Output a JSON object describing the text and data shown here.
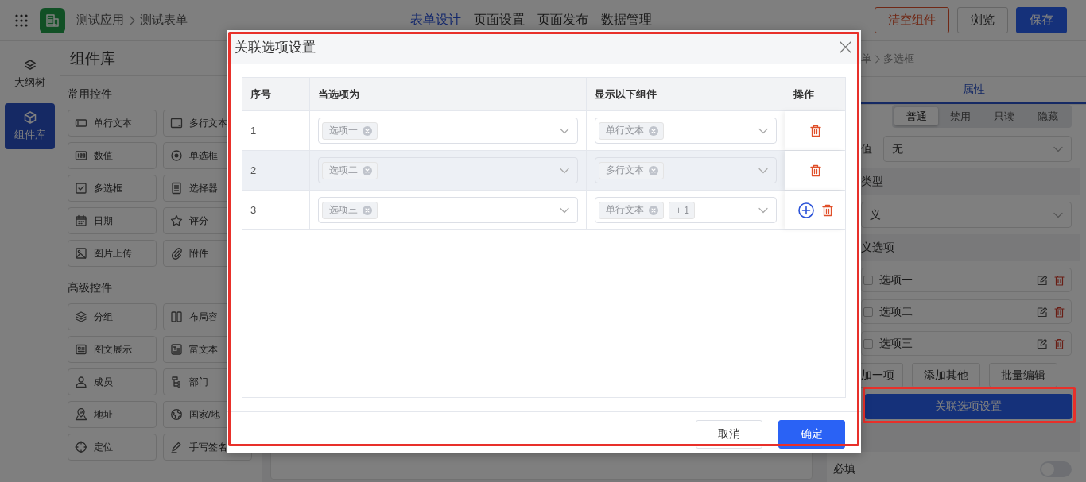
{
  "top_bar": {
    "breadcrumb": [
      "测试应用",
      "测试表单"
    ],
    "tabs": [
      {
        "label": "表单设计",
        "selected": true
      },
      {
        "label": "页面设置",
        "selected": false
      },
      {
        "label": "页面发布",
        "selected": false
      },
      {
        "label": "数据管理",
        "selected": false
      }
    ],
    "buttons": [
      {
        "label": "清空组件",
        "kind": "danger"
      },
      {
        "label": "浏览",
        "kind": "default"
      },
      {
        "label": "保存",
        "kind": "primary"
      }
    ]
  },
  "rail": [
    {
      "label": "大纲树",
      "selected": false
    },
    {
      "label": "组件库",
      "selected": true
    }
  ],
  "library": {
    "title": "组件库",
    "groups": [
      {
        "title": "常用控件",
        "items": [
          "单行文本",
          "多行文本",
          "数值",
          "单选框",
          "多选框",
          "选择器",
          "日期",
          "评分",
          "图片上传",
          "附件"
        ]
      },
      {
        "title": "高级控件",
        "items": [
          "分组",
          "布局容",
          "图文展示",
          "富文本",
          "成员",
          "部门",
          "地址",
          "国家/地",
          "定位",
          "手写签名"
        ]
      }
    ]
  },
  "properties": {
    "breadcrumb": [
      "单",
      "多选框"
    ],
    "tabs": [
      {
        "label": "属性",
        "selected": true
      }
    ],
    "modes": [
      {
        "label": "普通",
        "selected": true
      },
      {
        "label": "禁用",
        "selected": false
      },
      {
        "label": "只读",
        "selected": false
      },
      {
        "label": "隐藏",
        "selected": false
      }
    ],
    "default_label": "值",
    "default_value": "无",
    "type_section": "类型",
    "type_value": "义",
    "options_section": "义选项",
    "options": [
      {
        "label": "选项一",
        "checked": false
      },
      {
        "label": "选项二",
        "checked": false
      },
      {
        "label": "选项三",
        "checked": false
      }
    ],
    "option_buttons": [
      "加一项",
      "添加其他",
      "批量编辑"
    ],
    "link_button": {
      "label": "关联选项设置",
      "highlighted": true
    },
    "required": {
      "label": "必填",
      "on": false
    }
  },
  "dialog": {
    "title": "关联选项设置",
    "highlighted": true,
    "columns": [
      "序号",
      "当选项为",
      "显示以下组件",
      "操作"
    ],
    "rows": [
      {
        "index": "1",
        "hovered": false,
        "when": [
          "选项一"
        ],
        "show": [
          "单行文本"
        ],
        "more": null,
        "addable": false
      },
      {
        "index": "2",
        "hovered": true,
        "when": [
          "选项二"
        ],
        "show": [
          "多行文本"
        ],
        "more": null,
        "addable": false
      },
      {
        "index": "3",
        "hovered": false,
        "when": [
          "选项三"
        ],
        "show": [
          "单行文本"
        ],
        "more": "+ 1",
        "addable": true
      }
    ],
    "buttons": [
      {
        "label": "取消",
        "kind": "default"
      },
      {
        "label": "确定",
        "kind": "primary"
      }
    ]
  }
}
